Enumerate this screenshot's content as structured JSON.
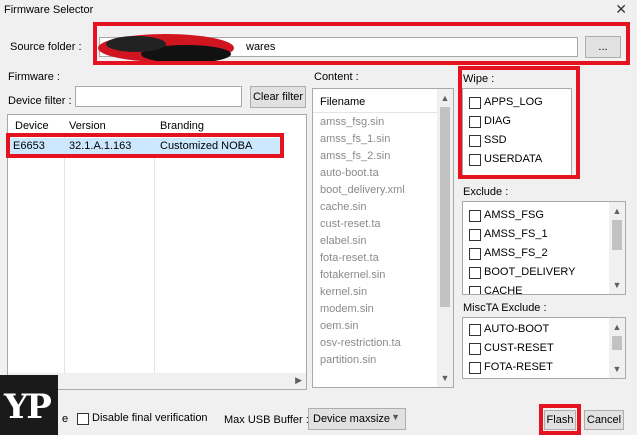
{
  "window": {
    "title": "Firmware Selector",
    "close_glyph": "✕"
  },
  "source": {
    "label": "Source folder :",
    "value_suffix": "wares",
    "browse_label": "..."
  },
  "firmware": {
    "label": "Firmware :",
    "filter_label": "Device filter :",
    "filter_value": "",
    "clear_label": "Clear filter",
    "columns": [
      "Device",
      "Version",
      "Branding"
    ],
    "rows": [
      {
        "device": "E6653",
        "version": "32.1.A.1.163",
        "branding": "Customized NOBA"
      }
    ]
  },
  "content": {
    "label": "Content :",
    "header": "Filename",
    "items": [
      "amss_fsg.sin",
      "amss_fs_1.sin",
      "amss_fs_2.sin",
      "auto-boot.ta",
      "boot_delivery.xml",
      "cache.sin",
      "cust-reset.ta",
      "elabel.sin",
      "fota-reset.ta",
      "fotakernel.sin",
      "kernel.sin",
      "modem.sin",
      "oem.sin",
      "osv-restriction.ta",
      "partition.sin"
    ]
  },
  "wipe": {
    "label": "Wipe :",
    "items": [
      "APPS_LOG",
      "DIAG",
      "SSD",
      "USERDATA"
    ]
  },
  "exclude": {
    "label": "Exclude :",
    "items": [
      "AMSS_FSG",
      "AMSS_FS_1",
      "AMSS_FS_2",
      "BOOT_DELIVERY",
      "CACHE"
    ]
  },
  "miscta": {
    "label": "MiscTA Exclude :",
    "items": [
      "AUTO-BOOT",
      "CUST-RESET",
      "FOTA-RESET"
    ]
  },
  "bottom": {
    "partial_label": "e",
    "disable_verification": "Disable final verification",
    "usb_label": "Max USB Buffer :",
    "usb_value": "Device maxsize",
    "flash_label": "Flash",
    "cancel_label": "Cancel"
  },
  "watermark": {
    "text": "YP"
  },
  "colors": {
    "highlight": "#e4131f",
    "selection": "#cce8ff"
  }
}
